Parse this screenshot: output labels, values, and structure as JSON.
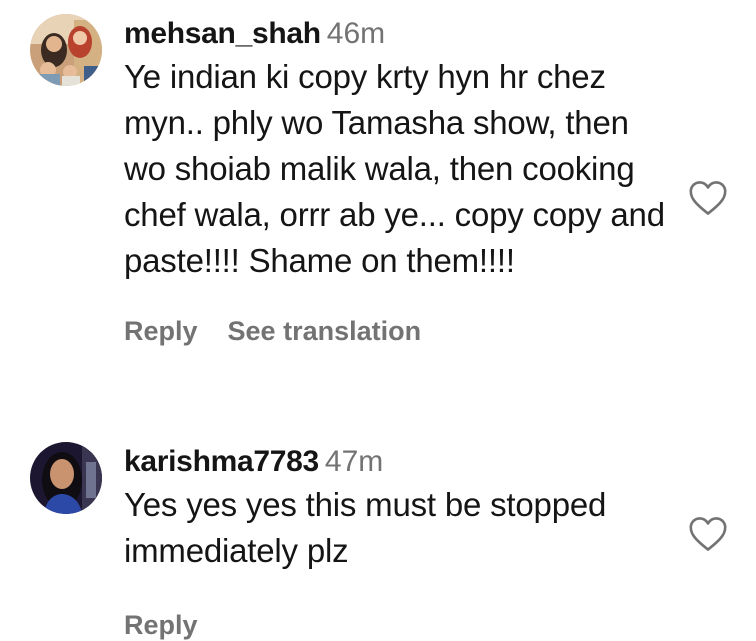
{
  "comments": [
    {
      "username": "mehsan_shah",
      "time": "46m",
      "text": "Ye indian ki copy krty hyn hr chez myn.. phly wo Tamasha show, then wo shoiab malik wala, then cooking chef wala, orrr ab ye... copy copy and paste!!!! Shame on them!!!!",
      "reply_label": "Reply",
      "translation_label": "See translation",
      "like_icon": "heart-outline-icon"
    },
    {
      "username": "karishma7783",
      "time": "47m",
      "text": "Yes yes yes this must be stopped immediately plz",
      "reply_label": "Reply",
      "like_icon": "heart-outline-icon"
    }
  ],
  "colors": {
    "text": "#151515",
    "muted": "#737373",
    "background": "#ffffff"
  }
}
